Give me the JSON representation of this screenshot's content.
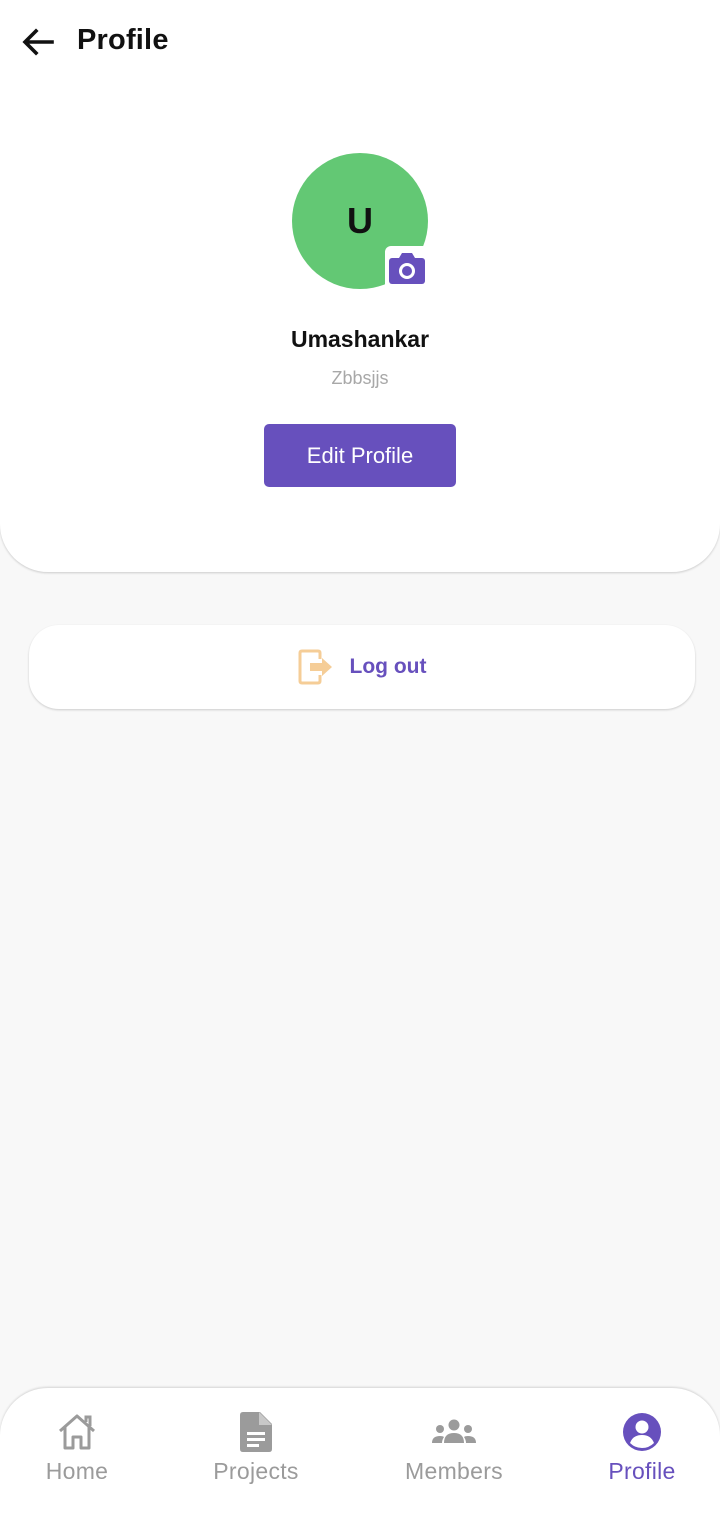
{
  "header": {
    "title": "Profile",
    "back_icon": "arrow-left-icon"
  },
  "profile": {
    "initial": "U",
    "name": "Umashankar",
    "subtitle": "Zbbsjjs",
    "avatar_color": "#63c874",
    "camera_icon": "camera-icon",
    "edit_button_label": "Edit Profile"
  },
  "logout": {
    "label": "Log out",
    "icon": "logout-icon",
    "icon_color": "#f5cd97",
    "label_color": "#6750bd"
  },
  "bottom_nav": {
    "items": [
      {
        "label": "Home",
        "icon": "home-icon",
        "active": false
      },
      {
        "label": "Projects",
        "icon": "document-icon",
        "active": false
      },
      {
        "label": "Members",
        "icon": "group-icon",
        "active": false
      },
      {
        "label": "Profile",
        "icon": "account-circle-icon",
        "active": true
      }
    ]
  },
  "colors": {
    "accent": "#6750bd",
    "inactive": "#9b9b9b",
    "background": "#f8f8f8"
  }
}
